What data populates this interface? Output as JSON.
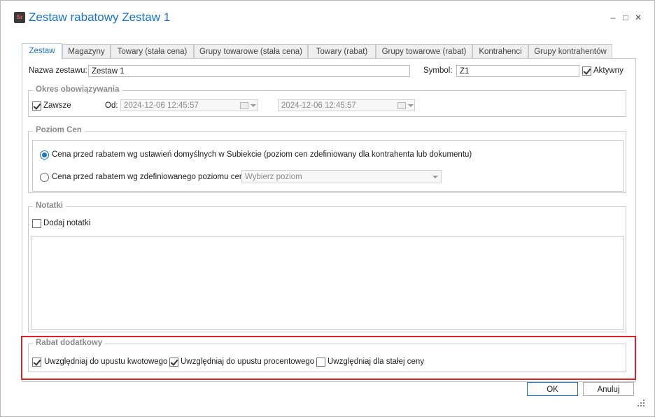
{
  "window": {
    "title": "Zestaw rabatowy Zestaw 1",
    "app_icon_text": "Sr"
  },
  "tabs": [
    "Zestaw",
    "Magazyny",
    "Towary (stała cena)",
    "Grupy towarowe (stała cena)",
    "Towary (rabat)",
    "Grupy towarowe (rabat)",
    "Kontrahenci",
    "Grupy kontrahentów"
  ],
  "form": {
    "name_label": "Nazwa zestawu:",
    "name_value": "Zestaw 1",
    "symbol_label": "Symbol:",
    "symbol_value": "Z1",
    "active_label": "Aktywny",
    "active_checked": true
  },
  "validity": {
    "legend": "Okres obowiązywania",
    "always_label": "Zawsze",
    "always_checked": true,
    "from_label": "Od:",
    "from_value": "2024-12-06 12:45:57",
    "to_value": "2024-12-06 12:45:57"
  },
  "price_level": {
    "legend": "Poziom Cen",
    "option1": "Cena przed rabatem wg ustawień domyślnych w Subiekcie (poziom cen zdefiniowany dla kontrahenta lub dokumentu)",
    "option2": "Cena przed rabatem wg zdefiniowanego poziomu cen",
    "selected": 1,
    "level_placeholder": "Wybierz poziom"
  },
  "notes": {
    "legend": "Notatki",
    "add_label": "Dodaj notatki",
    "add_checked": false,
    "text": ""
  },
  "extra_discount": {
    "legend": "Rabat dodatkowy",
    "amount_label": "Uwzględniaj do upustu kwotowego",
    "amount_checked": true,
    "percent_label": "Uwzględniaj do upustu procentowego",
    "percent_checked": true,
    "fixed_label": "Uwzględniaj dla stałej ceny",
    "fixed_checked": false
  },
  "buttons": {
    "ok": "OK",
    "cancel": "Anuluj"
  },
  "colors": {
    "accent": "#1a73c7",
    "highlight": "#d7242b"
  }
}
